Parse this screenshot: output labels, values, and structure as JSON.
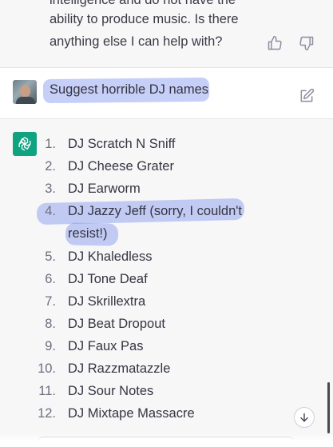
{
  "previous_message": {
    "lines": [
      "intelligence and do not have the",
      "ability to produce music. Is there",
      "anything else I can help with?"
    ],
    "thumbs_up_icon": "thumbs-up-icon",
    "thumbs_down_icon": "thumbs-down-icon"
  },
  "user_message": {
    "text": "Suggest horrible DJ names",
    "avatar_icon": "user-avatar",
    "edit_icon": "edit-icon"
  },
  "assistant_message": {
    "logo_icon": "openai-logo-icon",
    "items": [
      {
        "num": "1.",
        "text": "DJ Scratch N Sniff"
      },
      {
        "num": "2.",
        "text": "DJ Cheese Grater"
      },
      {
        "num": "3.",
        "text": "DJ Earworm"
      },
      {
        "num": "4.",
        "text": "DJ Jazzy Jeff (sorry, I couldn't resist!)"
      },
      {
        "num": "5.",
        "text": "DJ Khaledless"
      },
      {
        "num": "6.",
        "text": "DJ Tone Deaf"
      },
      {
        "num": "7.",
        "text": "DJ Skrillextra"
      },
      {
        "num": "8.",
        "text": "DJ Beat Dropout"
      },
      {
        "num": "9.",
        "text": "DJ Faux Pas"
      },
      {
        "num": "10.",
        "text": "DJ Razzmatazzle"
      },
      {
        "num": "11.",
        "text": "DJ Sour Notes"
      },
      {
        "num": "12.",
        "text": "DJ Mixtape Massacre"
      }
    ]
  },
  "scroll_down_icon": "arrow-down-icon",
  "colors": {
    "assistant_bg": "#f7f7f8",
    "logo_green": "#10a37f",
    "highlight": "#788ceb"
  }
}
